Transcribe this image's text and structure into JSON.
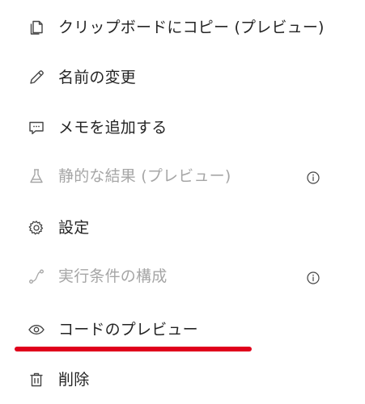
{
  "menu": {
    "items": [
      {
        "label": "クリップボードにコピー (プレビュー)",
        "icon": "copy-icon",
        "enabled": true
      },
      {
        "label": "名前の変更",
        "icon": "pencil-icon",
        "enabled": true
      },
      {
        "label": "メモを追加する",
        "icon": "comment-icon",
        "enabled": true
      },
      {
        "label": "静的な結果 (プレビュー)",
        "icon": "beaker-icon",
        "enabled": false,
        "info": true
      },
      {
        "label": "設定",
        "icon": "gear-icon",
        "enabled": true
      },
      {
        "label": "実行条件の構成",
        "icon": "run-after-icon",
        "enabled": false,
        "info": true
      },
      {
        "label": "コードのプレビュー",
        "icon": "eye-icon",
        "enabled": true,
        "highlighted": true
      },
      {
        "label": "削除",
        "icon": "trash-icon",
        "enabled": true
      }
    ]
  },
  "colors": {
    "text": "#242424",
    "disabled_text": "#a6a6a6",
    "highlight": "#e0001b"
  }
}
